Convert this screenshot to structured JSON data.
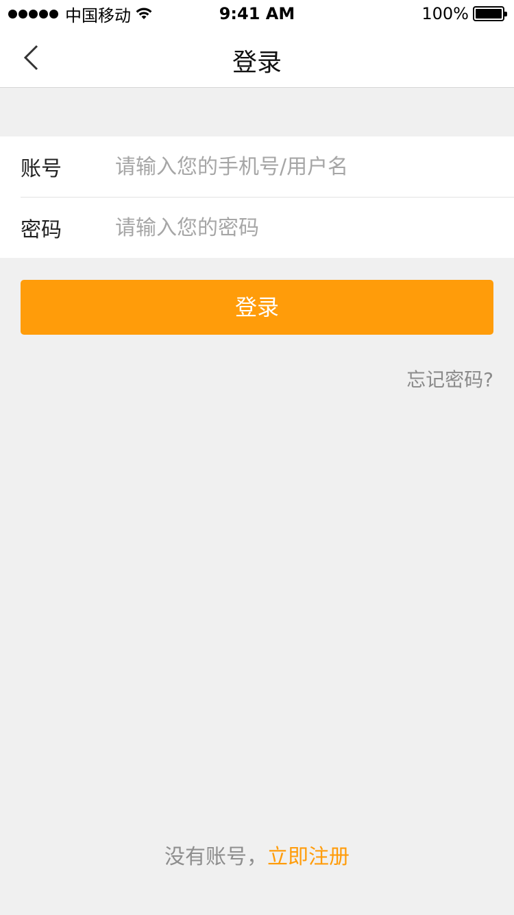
{
  "status_bar": {
    "carrier": "中国移动",
    "time": "9:41 AM",
    "battery_text": "100%",
    "battery_level": 1.0
  },
  "nav": {
    "title": "登录",
    "back_icon": "chevron-left-icon"
  },
  "form": {
    "account": {
      "label": "账号",
      "placeholder": "请输入您的手机号/用户名",
      "value": ""
    },
    "password": {
      "label": "密码",
      "placeholder": "请输入您的密码",
      "value": ""
    }
  },
  "actions": {
    "login_label": "登录",
    "forgot_label": "忘记密码?"
  },
  "footer": {
    "no_account_text": "没有账号，",
    "register_label": "立即注册"
  },
  "colors": {
    "accent": "#ff9c0a",
    "background": "#f0f0f0",
    "placeholder": "#a6a6a6"
  }
}
